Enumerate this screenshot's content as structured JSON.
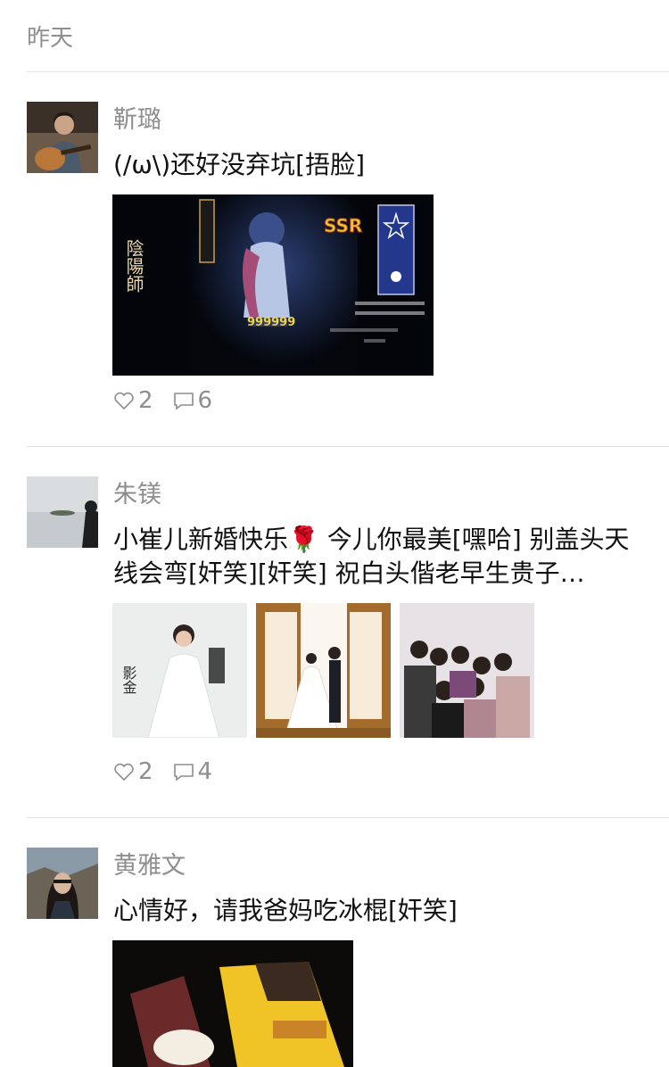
{
  "section": {
    "title": "昨天"
  },
  "posts": [
    {
      "author": "靳璐",
      "text": "(/ω\\)还好没弃坑[捂脸]",
      "likes": "2",
      "comments": "6",
      "avatar_icon": "avatar-guitar-player",
      "image": {
        "calligraphy": "陰陽師",
        "badge": "SSR",
        "price": "999999"
      }
    },
    {
      "author": "朱镁",
      "text": "小崔儿新婚快乐🌹 今儿你最美[嘿哈] 别盖头天线会弯[奸笑][奸笑] 祝白头偕老早生贵子…",
      "likes": "2",
      "comments": "4",
      "avatar_icon": "avatar-lake-silhouette"
    },
    {
      "author": "黄雅文",
      "text": "心情好，请我爸妈吃冰棍[奸笑]",
      "avatar_icon": "avatar-woman-glasses"
    }
  ],
  "colors": {
    "heart": "#8e8e8e",
    "comment": "#8e8e8e",
    "text": "#111111",
    "meta": "#8e8e8e"
  }
}
